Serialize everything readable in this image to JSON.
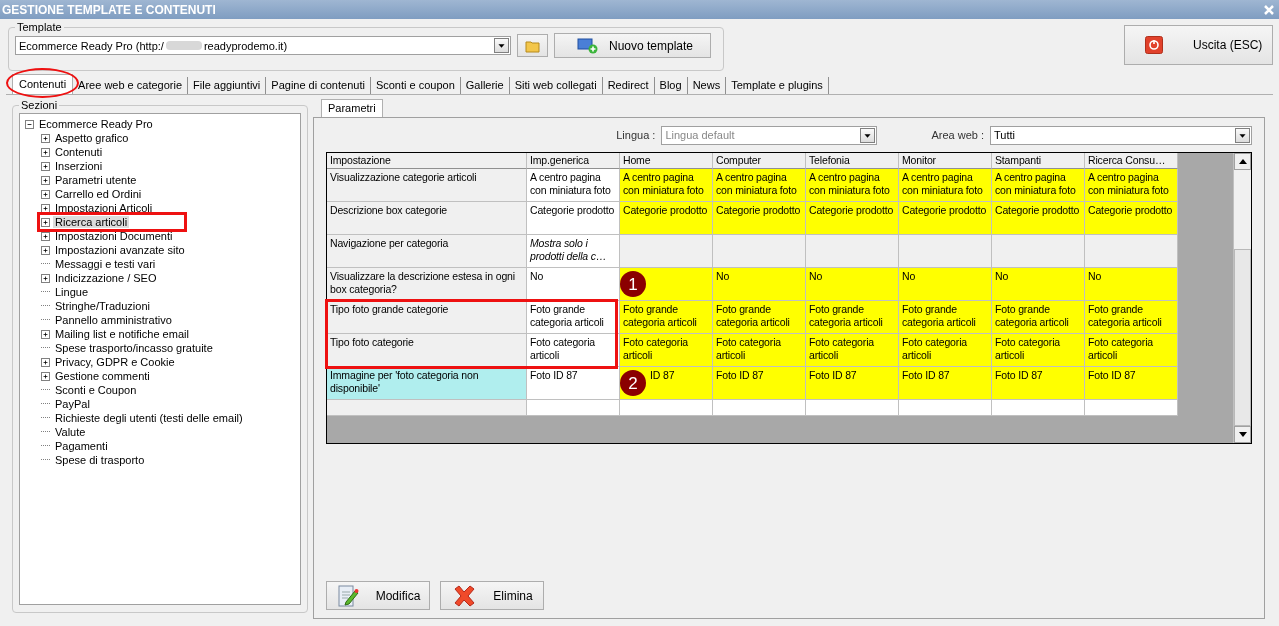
{
  "window": {
    "title": "GESTIONE TEMPLATE E CONTENUTI"
  },
  "template": {
    "legend": "Template",
    "value_start": "Ecommerce Ready Pro (http:/",
    "value_end": "readyprodemo.it)",
    "new_button": "Nuovo template"
  },
  "exit_button": "Uscita (ESC)",
  "tabs": [
    {
      "label": "Contenuti",
      "selected": true,
      "circled": true
    },
    {
      "label": "Aree web e categorie",
      "selected": false,
      "circled": false
    },
    {
      "label": "File aggiuntivi",
      "selected": false,
      "circled": false
    },
    {
      "label": "Pagine di contenuti",
      "selected": false,
      "circled": false
    },
    {
      "label": "Sconti e coupon",
      "selected": false,
      "circled": false
    },
    {
      "label": "Gallerie",
      "selected": false,
      "circled": false
    },
    {
      "label": "Siti web collegati",
      "selected": false,
      "circled": false
    },
    {
      "label": "Redirect",
      "selected": false,
      "circled": false
    },
    {
      "label": "Blog",
      "selected": false,
      "circled": false
    },
    {
      "label": "News",
      "selected": false,
      "circled": false
    },
    {
      "label": "Template e plugins",
      "selected": false,
      "circled": false
    }
  ],
  "sections": {
    "legend": "Sezioni",
    "tree": [
      {
        "label": "Ecommerce Ready Pro",
        "expanded": true,
        "selected": false,
        "outlined": false,
        "children": [
          {
            "label": "Aspetto grafico",
            "expanded": false,
            "selected": false,
            "outlined": false
          },
          {
            "label": "Contenuti",
            "expanded": false,
            "selected": false,
            "outlined": false
          },
          {
            "label": "Inserzioni",
            "expanded": false,
            "selected": false,
            "outlined": false
          },
          {
            "label": "Parametri utente",
            "expanded": false,
            "selected": false,
            "outlined": false
          },
          {
            "label": "Carrello ed Ordini",
            "expanded": false,
            "selected": false,
            "outlined": false
          },
          {
            "label": "Impostazioni Articoli",
            "expanded": false,
            "selected": false,
            "outlined": false
          },
          {
            "label": "Ricerca articoli",
            "expanded": false,
            "selected": true,
            "outlined": true
          },
          {
            "label": "Impostazioni Documenti",
            "expanded": false,
            "selected": false,
            "outlined": false
          },
          {
            "label": "Impostazioni avanzate sito",
            "expanded": false,
            "selected": false,
            "outlined": false
          },
          {
            "label": "Messaggi e testi vari",
            "selected": false,
            "outlined": false
          },
          {
            "label": "Indicizzazione / SEO",
            "expanded": false,
            "selected": false,
            "outlined": false
          },
          {
            "label": "Lingue",
            "selected": false,
            "outlined": false
          },
          {
            "label": "Stringhe/Traduzioni",
            "selected": false,
            "outlined": false
          },
          {
            "label": "Pannello amministrativo",
            "selected": false,
            "outlined": false
          },
          {
            "label": "Mailing list e notifiche email",
            "expanded": false,
            "selected": false,
            "outlined": false
          },
          {
            "label": "Spese trasporto/incasso gratuite",
            "selected": false,
            "outlined": false
          },
          {
            "label": "Privacy, GDPR e Cookie",
            "expanded": false,
            "selected": false,
            "outlined": false
          },
          {
            "label": "Gestione commenti",
            "expanded": false,
            "selected": false,
            "outlined": false
          },
          {
            "label": "Sconti e Coupon",
            "selected": false,
            "outlined": false
          },
          {
            "label": "PayPal",
            "selected": false,
            "outlined": false
          },
          {
            "label": "Richieste degli utenti (testi delle email)",
            "selected": false,
            "outlined": false
          },
          {
            "label": "Valute",
            "selected": false,
            "outlined": false
          },
          {
            "label": "Pagamenti",
            "selected": false,
            "outlined": false
          },
          {
            "label": "Spese di trasporto",
            "selected": false,
            "outlined": false
          }
        ]
      }
    ]
  },
  "subtabs": [
    {
      "label": "Parametri",
      "selected": true
    }
  ],
  "lingua": {
    "label": "Lingua :",
    "placeholder": "Lingua default"
  },
  "area_web": {
    "label": "Area web :",
    "value": "Tutti"
  },
  "table": {
    "columns": [
      "Impostazione",
      "Imp.generica",
      "Home",
      "Computer",
      "Telefonia",
      "Monitor",
      "Stampanti",
      "Ricerca Consu…"
    ],
    "rows": [
      {
        "outlined": false,
        "cells": [
          {
            "text": "Visualizzazione categorie articoli",
            "color": "#f0f0f0"
          },
          {
            "text": "A centro pagina con miniatura foto",
            "color": "#ffffff"
          },
          {
            "text": "A centro pagina con miniatura foto",
            "color": "#ffff00"
          },
          {
            "text": "A centro pagina con miniatura foto",
            "color": "#ffff00"
          },
          {
            "text": "A centro pagina con miniatura foto",
            "color": "#ffff00"
          },
          {
            "text": "A centro pagina con miniatura foto",
            "color": "#ffff00"
          },
          {
            "text": "A centro pagina con miniatura foto",
            "color": "#ffff00"
          },
          {
            "text": "A centro pagina con miniatura foto",
            "color": "#ffff00"
          }
        ]
      },
      {
        "outlined": false,
        "cells": [
          {
            "text": "Descrizione box categorie",
            "color": "#f0f0f0"
          },
          {
            "text": "Categorie prodotto",
            "color": "#ffffff"
          },
          {
            "text": "Categorie prodotto",
            "color": "#ffff00"
          },
          {
            "text": "Categorie prodotto",
            "color": "#ffff00"
          },
          {
            "text": "Categorie prodotto",
            "color": "#ffff00"
          },
          {
            "text": "Categorie prodotto",
            "color": "#ffff00"
          },
          {
            "text": "Categorie prodotto",
            "color": "#ffff00"
          },
          {
            "text": "Categorie prodotto",
            "color": "#ffff00"
          }
        ]
      },
      {
        "outlined": false,
        "cells": [
          {
            "text": "Navigazione per categoria",
            "color": "#f0f0f0"
          },
          {
            "text": "Mostra solo i prodotti della c…",
            "color": "#ffffff",
            "italic": true
          },
          {
            "color": "#f0f0f0"
          },
          {
            "color": "#f0f0f0"
          },
          {
            "color": "#f0f0f0"
          },
          {
            "color": "#f0f0f0"
          },
          {
            "color": "#f0f0f0"
          },
          {
            "color": "#f0f0f0"
          }
        ]
      },
      {
        "outlined": false,
        "cells": [
          {
            "text": "Visualizzare la descrizione estesa in ogni box categoria?",
            "color": "#f0f0f0"
          },
          {
            "text": "No",
            "color": "#ffffff"
          },
          {
            "color": "#ffff00",
            "marker": "1"
          },
          {
            "text": "No",
            "color": "#ffff00"
          },
          {
            "text": "No",
            "color": "#ffff00"
          },
          {
            "text": "No",
            "color": "#ffff00"
          },
          {
            "text": "No",
            "color": "#ffff00"
          },
          {
            "text": "No",
            "color": "#ffff00"
          }
        ]
      },
      {
        "outlined": true,
        "cells": [
          {
            "text": "Tipo foto grande categorie",
            "color": "#f0f0f0"
          },
          {
            "text": "Foto grande categoria articoli",
            "color": "#ffffff"
          },
          {
            "text": "Foto grande categoria articoli",
            "color": "#ffff00"
          },
          {
            "text": "Foto grande categoria articoli",
            "color": "#ffff00"
          },
          {
            "text": "Foto grande categoria articoli",
            "color": "#ffff00"
          },
          {
            "text": "Foto grande categoria articoli",
            "color": "#ffff00"
          },
          {
            "text": "Foto grande categoria articoli",
            "color": "#ffff00"
          },
          {
            "text": "Foto grande categoria articoli",
            "color": "#ffff00"
          }
        ]
      },
      {
        "outlined": true,
        "cells": [
          {
            "text": "Tipo foto categorie",
            "color": "#f0f0f0"
          },
          {
            "text": "Foto categoria articoli",
            "color": "#ffffff"
          },
          {
            "text": "Foto categoria articoli",
            "color": "#ffff00"
          },
          {
            "text": "Foto categoria articoli",
            "color": "#ffff00"
          },
          {
            "text": "Foto categoria articoli",
            "color": "#ffff00"
          },
          {
            "text": "Foto categoria articoli",
            "color": "#ffff00"
          },
          {
            "text": "Foto categoria articoli",
            "color": "#ffff00"
          },
          {
            "text": "Foto categoria articoli",
            "color": "#ffff00"
          }
        ]
      },
      {
        "outlined": false,
        "cells": [
          {
            "text": "Immagine per 'foto categoria non disponibile'",
            "color": "#b0eeee"
          },
          {
            "text": "Foto ID 87",
            "color": "#ffffff"
          },
          {
            "text": "ID 87",
            "color": "#ffff00",
            "marker": "2"
          },
          {
            "text": "Foto ID 87",
            "color": "#ffff00"
          },
          {
            "text": "Foto ID 87",
            "color": "#ffff00"
          },
          {
            "text": "Foto ID 87",
            "color": "#ffff00"
          },
          {
            "text": "Foto ID 87",
            "color": "#ffff00"
          },
          {
            "text": "Foto ID 87",
            "color": "#ffff00"
          }
        ]
      },
      {
        "outlined": false,
        "cells": [
          {
            "color": "#f0f0f0"
          },
          {
            "color": "#ffffff"
          },
          {
            "color": "#ffffff"
          },
          {
            "color": "#ffffff"
          },
          {
            "color": "#ffffff"
          },
          {
            "color": "#ffffff"
          },
          {
            "color": "#ffffff"
          },
          {
            "color": "#ffffff"
          }
        ]
      }
    ]
  },
  "buttons": [
    {
      "label": "Modifica",
      "kind": "edit"
    },
    {
      "label": "Elimina",
      "kind": "delete"
    }
  ]
}
